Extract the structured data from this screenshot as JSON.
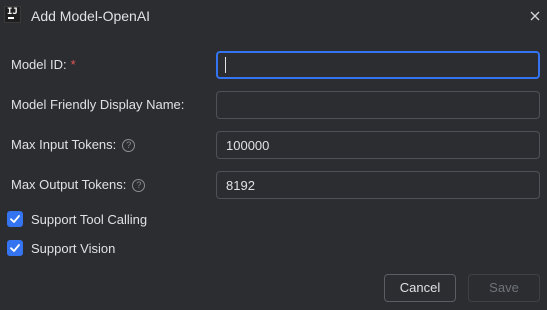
{
  "dialog": {
    "title": "Add Model-OpenAI",
    "app_icon": "jetbrains-app-icon",
    "app_icon_glyph": "IJ"
  },
  "form": {
    "model_id": {
      "label": "Model ID:",
      "required_mark": "*",
      "value": ""
    },
    "display_name": {
      "label": "Model Friendly Display Name:",
      "value": ""
    },
    "max_input_tokens": {
      "label": "Max Input Tokens:",
      "help": "?",
      "value": "100000"
    },
    "max_output_tokens": {
      "label": "Max Output Tokens:",
      "help": "?",
      "value": "8192"
    }
  },
  "checkboxes": {
    "tool_calling": {
      "label": "Support Tool Calling",
      "checked": true
    },
    "vision": {
      "label": "Support Vision",
      "checked": true
    }
  },
  "buttons": {
    "cancel": "Cancel",
    "save": "Save",
    "save_enabled": false
  },
  "colors": {
    "accent": "#3574f0",
    "required": "#e55757",
    "background": "#2b2d30"
  }
}
